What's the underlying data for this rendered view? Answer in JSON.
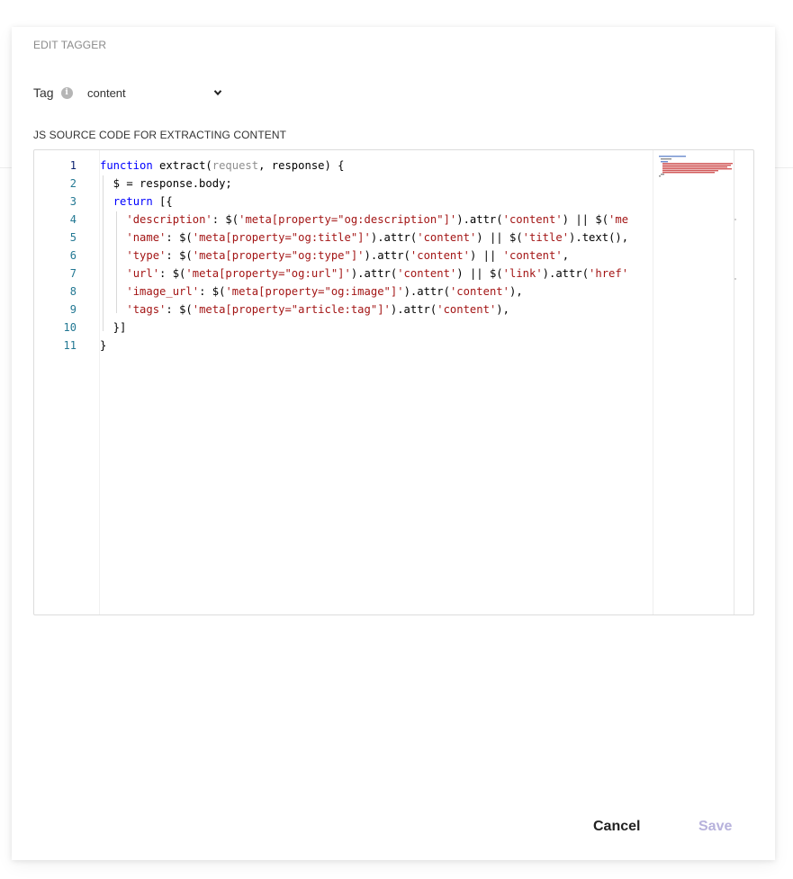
{
  "dialog": {
    "title": "EDIT TAGGER",
    "tag_label": "Tag",
    "tag_value": "content",
    "source_label": "JS SOURCE CODE FOR EXTRACTING CONTENT"
  },
  "editor": {
    "language": "javascript",
    "line_numbers": [
      "1",
      "2",
      "3",
      "4",
      "5",
      "6",
      "7",
      "8",
      "9",
      "10",
      "11"
    ],
    "lines": [
      "function extract(request, response) {",
      "  $ = response.body;",
      "  return [{",
      "    'description': $('meta[property=\"og:description\"]').attr('content') || $('me",
      "    'name': $('meta[property=\"og:title\"]').attr('content') || $('title').text(),",
      "    'type': $('meta[property=\"og:type\"]').attr('content') || 'content',",
      "    'url': $('meta[property=\"og:url\"]').attr('content') || $('link').attr('href'",
      "    'image_url': $('meta[property=\"og:image\"]').attr('content'),",
      "    'tags': $('meta[property=\"article:tag\"]').attr('content'),",
      "  }]",
      "}"
    ]
  },
  "actions": {
    "cancel": "Cancel",
    "save": "Save"
  },
  "colors": {
    "keyword": "#0000ff",
    "string": "#a31515",
    "param_unused": "#8f8f8f",
    "line_number": "#237893",
    "save_disabled": "#b7b2dc"
  },
  "icons": {
    "info": "info-icon",
    "dropdown": "chevron-down-icon"
  }
}
